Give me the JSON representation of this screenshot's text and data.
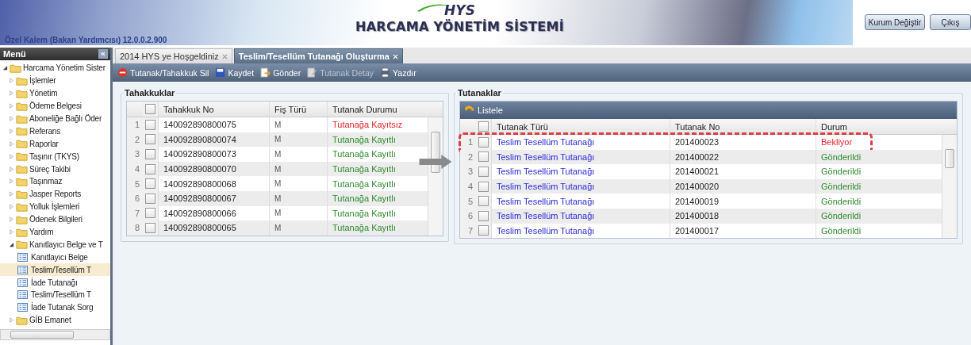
{
  "header": {
    "user_info": "Özel Kalem (Bakan Yardımcısı) 12.0.0.2.900",
    "logo": "HYS",
    "app_title": "HARCAMA YÖNETİM SİSTEMİ",
    "buttons": [
      "Kurum Değiştir",
      "Çıkış"
    ]
  },
  "sidebar": {
    "title": "Menü",
    "collapse": "«",
    "tree": [
      {
        "label": "Harcama Yönetim Sister",
        "kind": "folder",
        "expanded": true,
        "selected": false,
        "children": [
          {
            "label": "İşlemler",
            "kind": "folder",
            "expanded": false,
            "selected": false
          },
          {
            "label": "Yönetim",
            "kind": "folder",
            "expanded": false,
            "selected": false
          },
          {
            "label": "Ödeme Belgesi",
            "kind": "folder",
            "expanded": false,
            "selected": false
          },
          {
            "label": "Aboneliğe Bağlı Öder",
            "kind": "folder",
            "expanded": false,
            "selected": false
          },
          {
            "label": "Referans",
            "kind": "folder",
            "expanded": false,
            "selected": false
          },
          {
            "label": "Raporlar",
            "kind": "folder",
            "expanded": false,
            "selected": false
          },
          {
            "label": "Taşınır (TKYS)",
            "kind": "folder",
            "expanded": false,
            "selected": false
          },
          {
            "label": "Süreç Takibi",
            "kind": "folder",
            "expanded": false,
            "selected": false
          },
          {
            "label": "Taşınmaz",
            "kind": "folder",
            "expanded": false,
            "selected": false
          },
          {
            "label": "Jasper Reports",
            "kind": "folder",
            "expanded": false,
            "selected": false
          },
          {
            "label": "Yolluk İşlemleri",
            "kind": "folder",
            "expanded": false,
            "selected": false
          },
          {
            "label": "Ödenek Bilgileri",
            "kind": "folder",
            "expanded": false,
            "selected": false
          },
          {
            "label": "Yardım",
            "kind": "folder",
            "expanded": false,
            "selected": false
          },
          {
            "label": "Kanıtlayıcı Belge ve T",
            "kind": "folder",
            "expanded": true,
            "selected": false,
            "children": [
              {
                "label": "Kanıtlayıcı Belge",
                "kind": "form",
                "selected": false
              },
              {
                "label": "Teslim/Tesellüm T",
                "kind": "form",
                "selected": true
              },
              {
                "label": "İade Tutanağı",
                "kind": "form",
                "selected": false
              },
              {
                "label": "Teslim/Tesellüm T",
                "kind": "form",
                "selected": false
              },
              {
                "label": "İade Tutanak Sorg",
                "kind": "form",
                "selected": false
              }
            ]
          },
          {
            "label": "GİB Emanet",
            "kind": "folder",
            "expanded": false,
            "selected": false
          }
        ]
      }
    ]
  },
  "tabs": [
    {
      "label": "2014 HYS ye Hoşgeldiniz",
      "selected": false
    },
    {
      "label": "Teslim/Tesellüm Tutanağı Oluşturma",
      "selected": true
    }
  ],
  "toolbar": [
    {
      "label": "Tutanak/Tahakkuk Sil",
      "kind": "delete",
      "disabled": false
    },
    {
      "label": "Kaydet",
      "kind": "save",
      "disabled": false
    },
    {
      "label": "Gönder",
      "kind": "send",
      "disabled": false
    },
    {
      "label": "Tutanak Detay",
      "kind": "detail",
      "disabled": true
    },
    {
      "label": "Yazdır",
      "kind": "print",
      "disabled": false
    }
  ],
  "tahakkuklar": {
    "title": "Tahakkuklar",
    "header_checked": false,
    "columns": [
      "Tahakkuk No",
      "Fiş Türü",
      "Tutanak Durumu"
    ],
    "rows": [
      {
        "num": "1",
        "checked": false,
        "no": "140092890800075",
        "type": "M",
        "status": "Tutanağa Kayıtsız",
        "color": "#e8202a"
      },
      {
        "num": "2",
        "checked": false,
        "no": "140092890800074",
        "type": "M",
        "status": "Tutanağa Kayıtlı",
        "color": "#2e8b2e"
      },
      {
        "num": "3",
        "checked": false,
        "no": "140092890800073",
        "type": "M",
        "status": "Tutanağa Kayıtlı",
        "color": "#2e8b2e"
      },
      {
        "num": "4",
        "checked": false,
        "no": "140092890800070",
        "type": "M",
        "status": "Tutanağa Kayıtlı",
        "color": "#2e8b2e"
      },
      {
        "num": "5",
        "checked": false,
        "no": "140092890800068",
        "type": "M",
        "status": "Tutanağa Kayıtlı",
        "color": "#2e8b2e"
      },
      {
        "num": "6",
        "checked": false,
        "no": "140092890800067",
        "type": "M",
        "status": "Tutanağa Kayıtlı",
        "color": "#2e8b2e"
      },
      {
        "num": "7",
        "checked": false,
        "no": "140092890800066",
        "type": "M",
        "status": "Tutanağa Kayıtlı",
        "color": "#2e8b2e"
      },
      {
        "num": "8",
        "checked": false,
        "no": "140092890800065",
        "type": "M",
        "status": "Tutanağa Kayıtlı",
        "color": "#2e8b2e"
      }
    ]
  },
  "tutanaklar": {
    "title": "Tutanaklar",
    "list_button": "Listele",
    "header_checked": false,
    "columns": [
      "Tutanak Türü",
      "Tutanak No",
      "Durum"
    ],
    "rows": [
      {
        "num": "1",
        "checked": false,
        "type": "Teslim Tesellüm Tutanağı",
        "no": "201400023",
        "status": "Bekliyor",
        "color": "#e8202a",
        "highlighted": true
      },
      {
        "num": "2",
        "checked": false,
        "type": "Teslim Tesellüm Tutanağı",
        "no": "201400022",
        "status": "Gönderildi",
        "color": "#2e8b2e",
        "highlighted": false
      },
      {
        "num": "3",
        "checked": false,
        "type": "Teslim Tesellüm Tutanağı",
        "no": "201400021",
        "status": "Gönderildi",
        "color": "#2e8b2e",
        "highlighted": false
      },
      {
        "num": "4",
        "checked": false,
        "type": "Teslim Tesellüm Tutanağı",
        "no": "201400020",
        "status": "Gönderildi",
        "color": "#2e8b2e",
        "highlighted": false
      },
      {
        "num": "5",
        "checked": false,
        "type": "Teslim Tesellüm Tutanağı",
        "no": "201400019",
        "status": "Gönderildi",
        "color": "#2e8b2e",
        "highlighted": false
      },
      {
        "num": "6",
        "checked": false,
        "type": "Teslim Tesellüm Tutanağı",
        "no": "201400018",
        "status": "Gönderildi",
        "color": "#2e8b2e",
        "highlighted": false
      },
      {
        "num": "7",
        "checked": false,
        "type": "Teslim Tesellüm Tutanağı",
        "no": "201400017",
        "status": "Gönderildi",
        "color": "#2e8b2e",
        "highlighted": false
      }
    ]
  }
}
